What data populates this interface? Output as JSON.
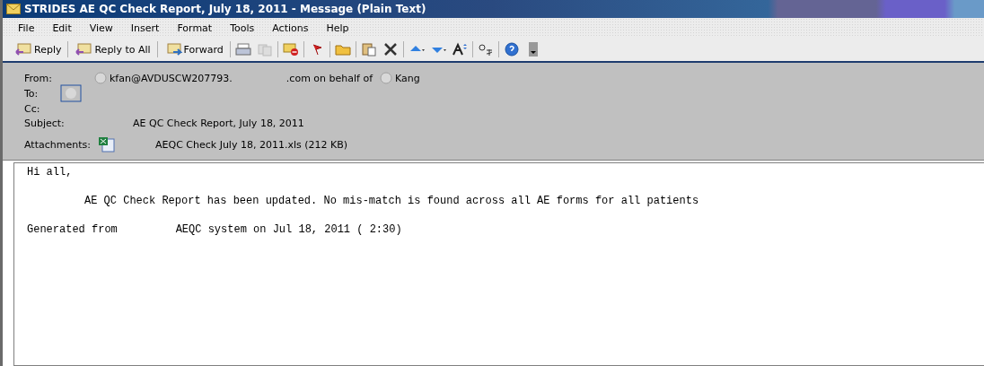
{
  "window": {
    "title": "STRIDES AE QC Check Report, July 18, 2011 - Message (Plain Text)"
  },
  "menu": [
    "File",
    "Edit",
    "View",
    "Insert",
    "Format",
    "Tools",
    "Actions",
    "Help"
  ],
  "toolbar": [
    {
      "kind": "text",
      "label": "Reply"
    },
    {
      "kind": "text",
      "label": "Reply to All"
    },
    {
      "kind": "text",
      "label": "Forward"
    }
  ],
  "header": {
    "from_label": "From:",
    "from_sender": "kfan@AVDUSCW207793.",
    "from_domain": ".com on behalf of",
    "from_name": "Kang",
    "to_label": "To:",
    "cc_label": "Cc:",
    "subject_label": "Subject:",
    "subject": "AE QC Check Report, July 18, 2011",
    "attachments_label": "Attachments:",
    "attachment": "AEQC Check July 18, 2011.xls (212 KB)"
  },
  "body": [
    {
      "kind": "line",
      "text": "Hi all,"
    },
    {
      "kind": "indent",
      "text": "AE QC Check Report has been updated. No mis-match is found across all AE forms for all patients"
    },
    {
      "kind": "line",
      "text": "Generated from         AEQC system on Jul 18, 2011 ( 2:30)"
    }
  ]
}
